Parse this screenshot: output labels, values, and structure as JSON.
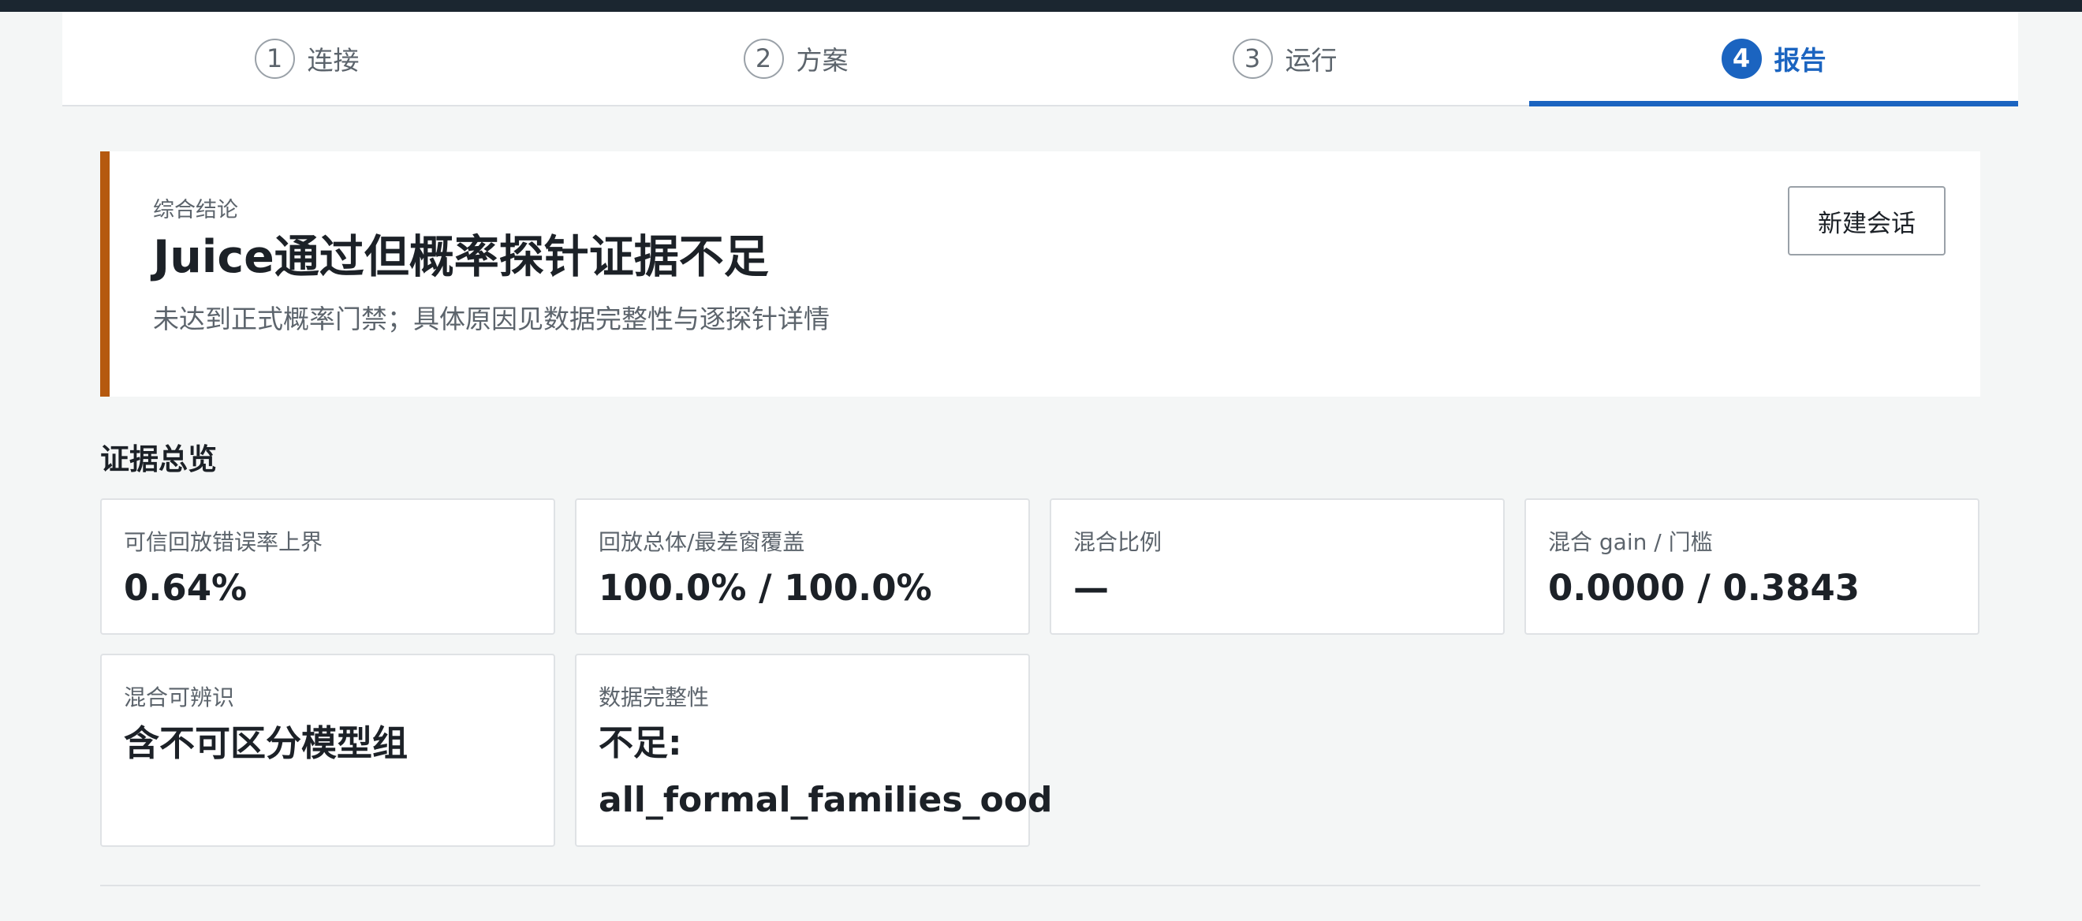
{
  "steps": [
    {
      "number": "1",
      "label": "连接"
    },
    {
      "number": "2",
      "label": "方案"
    },
    {
      "number": "3",
      "label": "运行"
    },
    {
      "number": "4",
      "label": "报告"
    }
  ],
  "active_step": "4",
  "verdict": {
    "eyebrow": "综合结论",
    "title": "Juice通过但概率探针证据不足",
    "subtitle": "未达到正式概率门禁；具体原因见数据完整性与逐探针详情",
    "accent_color": "#b5590f"
  },
  "toolbar": {
    "new_session_label": "新建会话"
  },
  "evidence": {
    "section_title": "证据总览",
    "cards": [
      {
        "label": "可信回放错误率上界",
        "value": "0.64%"
      },
      {
        "label": "回放总体/最差窗覆盖",
        "value": "100.0% / 100.0%"
      },
      {
        "label": "混合比例",
        "value": "—"
      },
      {
        "label": "混合 gain / 门槛",
        "value": "0.0000 / 0.3843"
      },
      {
        "label": "混合可辨识",
        "value": "含不可区分模型组"
      },
      {
        "label": "数据完整性",
        "value": "不足: all_formal_families_ood"
      }
    ]
  },
  "colors": {
    "primary": "#1b64c0",
    "background": "#f4f6f6",
    "topbar": "#1b2630"
  }
}
